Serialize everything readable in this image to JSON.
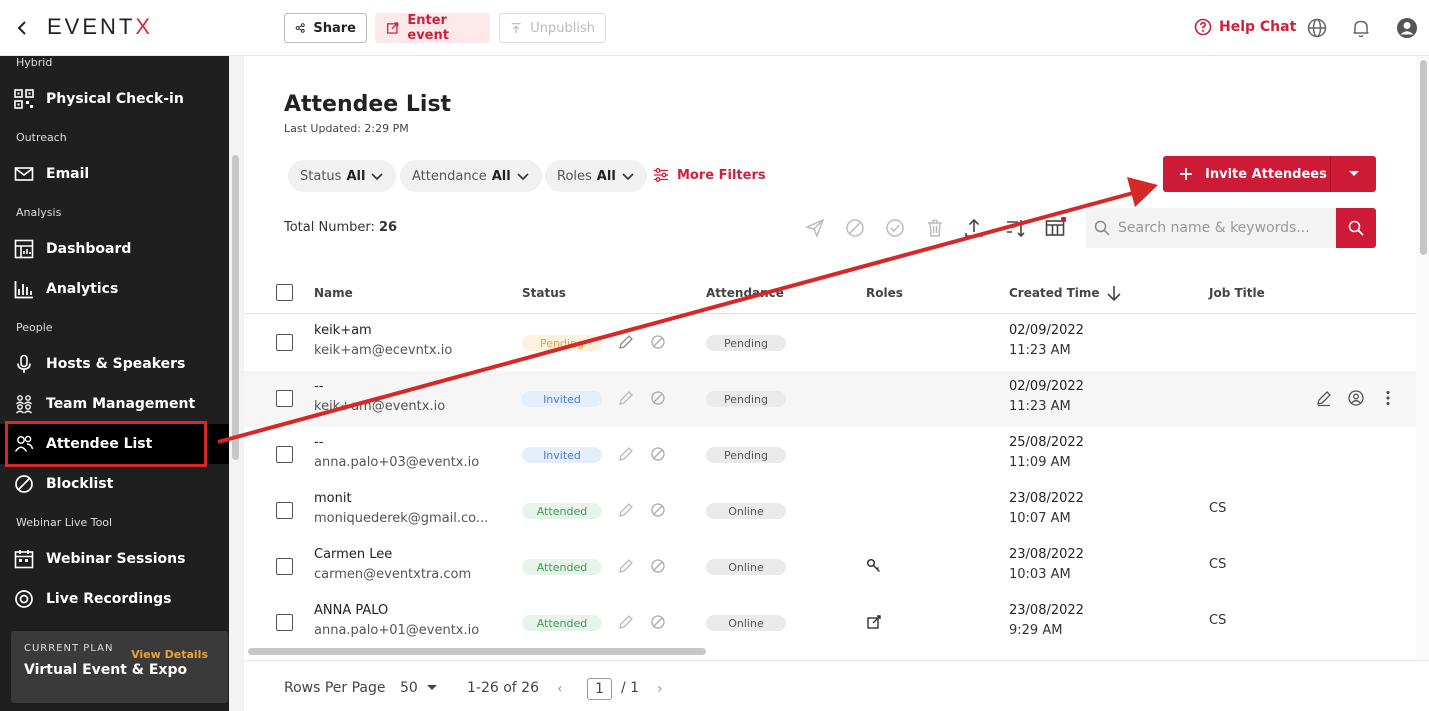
{
  "app": {
    "logo_prefix": "EVENT",
    "logo_suffix": "X"
  },
  "topbar": {
    "share": "Share",
    "enter_event": "Enter event",
    "unpublish": "Unpublish",
    "help_chat": "Help Chat"
  },
  "sidebar": {
    "sections": {
      "hybrid": "Hybrid",
      "outreach": "Outreach",
      "analysis": "Analysis",
      "people": "People",
      "webinar": "Webinar Live Tool"
    },
    "items": {
      "physical_checkin": "Physical Check-in",
      "email": "Email",
      "dashboard": "Dashboard",
      "analytics": "Analytics",
      "hosts_speakers": "Hosts & Speakers",
      "team_management": "Team Management",
      "attendee_list": "Attendee List",
      "blocklist": "Blocklist",
      "webinar_sessions": "Webinar Sessions",
      "live_recordings": "Live Recordings"
    },
    "plan": {
      "label": "CURRENT PLAN",
      "link": "View Details",
      "name": "Virtual Event & Expo"
    }
  },
  "main": {
    "title": "Attendee List",
    "last_updated": "Last Updated: 2:29 PM",
    "filters": [
      {
        "label": "Status",
        "value": "All"
      },
      {
        "label": "Attendance",
        "value": "All"
      },
      {
        "label": "Roles",
        "value": "All"
      }
    ],
    "more_filters": "More Filters",
    "invite_button": "Invite Attendees",
    "total_label": "Total Number:",
    "total_value": "26",
    "search_placeholder": "Search name & keywords...",
    "columns": {
      "name": "Name",
      "status": "Status",
      "attendance": "Attendance",
      "roles": "Roles",
      "created_time": "Created Time",
      "job_title": "Job Title"
    },
    "rows": [
      {
        "name": "keik+am",
        "email": "keik+am@ecevntx.io",
        "status": "Pending",
        "attendance": "Pending",
        "date": "02/09/2022",
        "time": "11:23 AM",
        "job": ""
      },
      {
        "name": "--",
        "email": "keik+am@eventx.io",
        "status": "Invited",
        "attendance": "Pending",
        "date": "02/09/2022",
        "time": "11:23 AM",
        "job": ""
      },
      {
        "name": "--",
        "email": "anna.palo+03@eventx.io",
        "status": "Invited",
        "attendance": "Pending",
        "date": "25/08/2022",
        "time": "11:09 AM",
        "job": ""
      },
      {
        "name": "monit",
        "email": "moniquederek@gmail.co...",
        "status": "Attended",
        "attendance": "Online",
        "date": "23/08/2022",
        "time": "10:07 AM",
        "job": "CS"
      },
      {
        "name": "Carmen Lee",
        "email": "carmen@eventxtra.com",
        "status": "Attended",
        "attendance": "Online",
        "date": "23/08/2022",
        "time": "10:03 AM",
        "job": "CS"
      },
      {
        "name": "ANNA PALO",
        "email": "anna.palo+01@eventx.io",
        "status": "Attended",
        "attendance": "Online",
        "date": "23/08/2022",
        "time": "9:29 AM",
        "job": "CS"
      }
    ]
  },
  "footer": {
    "rows_per_page_label": "Rows Per Page",
    "rows_per_page_value": "50",
    "range": "1-26 of 26",
    "page": "1",
    "total_pages": "/ 1"
  },
  "colors": {
    "accent": "#cd1a36",
    "sidebar_bg": "#1f1f1f",
    "annotation": "#d62828"
  }
}
